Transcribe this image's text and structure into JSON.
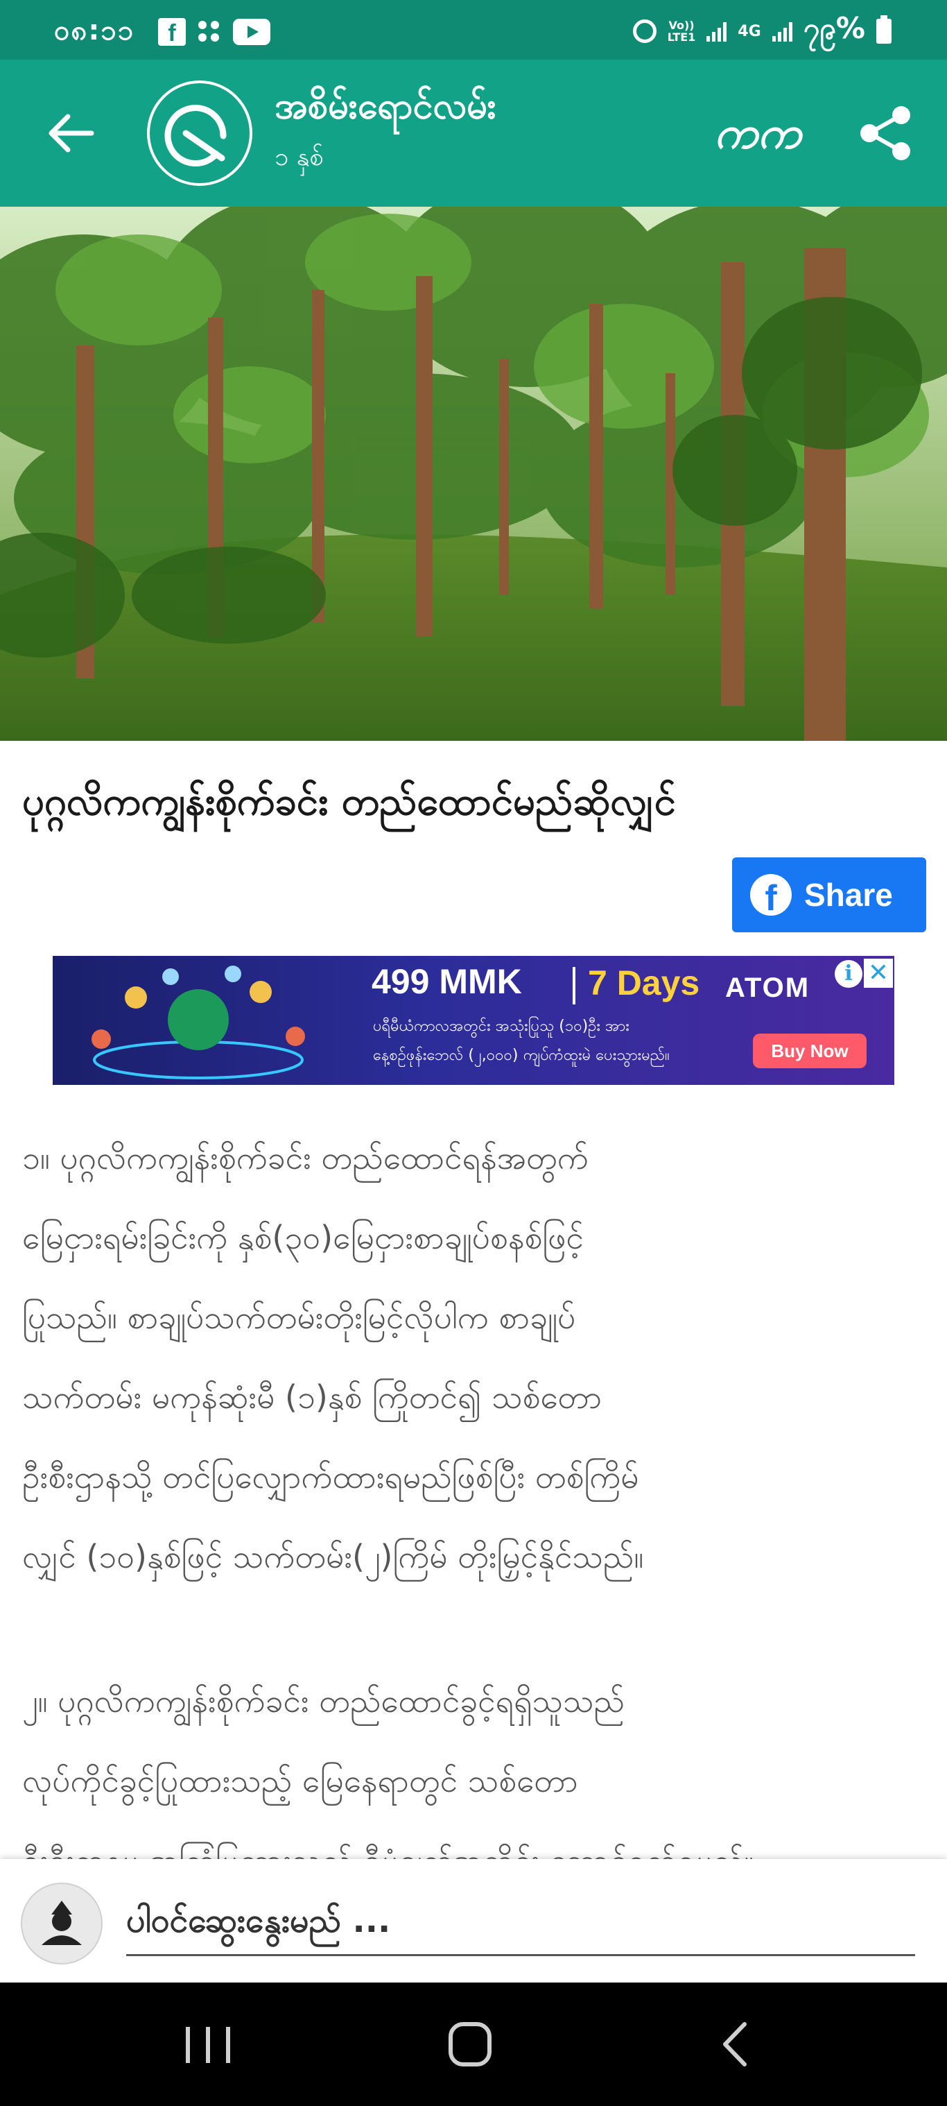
{
  "status_bar": {
    "time": "၀၈:၁၁",
    "network_label_1": "Vo))",
    "network_label_2": "LTE1",
    "signal_label": "4G",
    "battery": "၇၉%"
  },
  "app_bar": {
    "title": "အစိမ်းရောင်လမ်း",
    "subtitle": "၁ နှစ်",
    "font_button_label": "ကက"
  },
  "article": {
    "title": "ပုဂ္ဂလိကကျွန်းစိုက်ခင်း တည်ထောင်မည်ဆိုလျှင်",
    "share_label": "Share",
    "paragraphs": [
      "၁။ ပုဂ္ဂလိကကျွန်းစိုက်ခင်း တည်ထောင်ရန်အတွက်\nမြေငှားရမ်းခြင်းကို နှစ်(၃၀)မြေငှားစာချုပ်စနစ်ဖြင့်\nပြုသည်။ စာချုပ်သက်တမ်းတိုးမြင့်လိုပါက စာချုပ်\nသက်တမ်း မကုန်ဆုံးမီ (၁)နှစ် ကြိုတင်၍ သစ်တော\nဦးစီးဌာနသို့ တင်ပြလျှောက်ထားရမည်ဖြစ်ပြီး တစ်ကြိမ်\nလျှင် (၁၀)နှစ်ဖြင့် သက်တမ်း(၂)ကြိမ် တိုးမြှင့်နိုင်သည်။",
      "၂။ ပုဂ္ဂလိကကျွန်းစိုက်ခင်း တည်ထောင်ခွင့်ရရှိသူသည်\nလုပ်ကိုင်ခွင့်ပြုထားသည့် မြေနေရာတွင် သစ်တော\nဦးစီးဌာနမှ အကြံပြုထားသည့် စီမံချက်အတိုင်း ဆောင်ရွက်ရမည်။"
    ]
  },
  "ad": {
    "price": "499 MMK",
    "days": "7 Days",
    "brand": "ATOM",
    "line1": "ပရီမီယံကာလအတွင်း အသုံးပြုသူ (၁၀)ဦး အား",
    "line2": "နေ့စဉ်ဖုန်းဘေလ် (၂,၀၀၀) ကျပ်ကံထူးမဲ ပေးသွားမည်။",
    "buy_label": "Buy Now",
    "info_glyph": "i",
    "close_glyph": "✕"
  },
  "comment": {
    "placeholder": "ပါဝင်ဆွေးနွေးမည် ..."
  },
  "colors": {
    "status_bar": "#0f8a73",
    "app_bar": "#11a287",
    "facebook_blue": "#1877f2",
    "ad_background": "#2c2d9a",
    "ad_days": "#ffd23c",
    "ad_buy": "#ff5a6a"
  },
  "icons": {
    "status_left": [
      "facebook-icon",
      "dots-icon",
      "youtube-icon"
    ],
    "status_right": [
      "alarm-icon",
      "signal-icon",
      "battery-icon"
    ],
    "app_bar": [
      "back-arrow-icon",
      "logo-icon",
      "share-icon"
    ],
    "nav": [
      "recents-icon",
      "home-icon",
      "back-icon"
    ]
  }
}
